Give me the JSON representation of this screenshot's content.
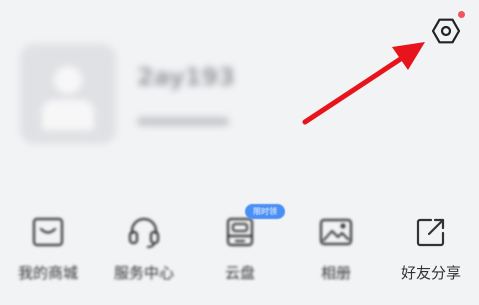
{
  "profile": {
    "username": "2ay193"
  },
  "header": {
    "settings_icon": "gear-hexagon-icon",
    "notification_dot_color": "#f2535e"
  },
  "annotation": {
    "arrow_color": "#e8141c"
  },
  "shortcuts": [
    {
      "label": "我的商城",
      "icon": "store-icon"
    },
    {
      "label": "服务中心",
      "icon": "headset-icon"
    },
    {
      "label": "云盘",
      "icon": "cloud-drive-icon",
      "badge": "限时领"
    },
    {
      "label": "相册",
      "icon": "image-icon"
    },
    {
      "label": "好友分享",
      "icon": "share-icon"
    }
  ]
}
